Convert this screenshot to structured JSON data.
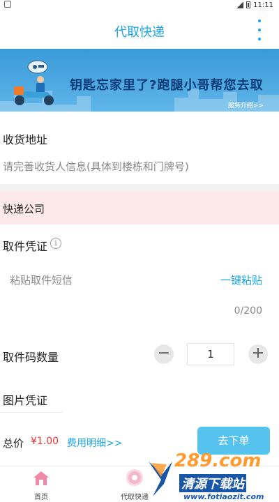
{
  "status_bar": {
    "time": "11:11"
  },
  "header": {
    "title": "代取快递"
  },
  "banner": {
    "slogan": "钥匙忘家里了?跑腿小哥帮您去取",
    "intro_link": "服务介绍>>"
  },
  "address": {
    "label": "收货地址",
    "placeholder": "请完善收货人信息(具体到楼栋和门牌号)"
  },
  "courier_company": {
    "label": "快递公司"
  },
  "pickup_proof": {
    "label": "取件凭证",
    "info_icon": "i",
    "sms_placeholder": "粘贴取件短信",
    "paste_button": "一键粘贴",
    "char_count": "0/200"
  },
  "quantity": {
    "label": "取件码数量",
    "value": "1",
    "minus": "−",
    "plus": "+"
  },
  "image_proof": {
    "label": "图片凭证"
  },
  "footer": {
    "total_label": "总价",
    "price": "¥1.00",
    "fee_details_link": "费用明细>>",
    "submit_button": "去下单"
  },
  "tabbar": {
    "tabs": [
      {
        "label": "首页",
        "icon": "home-icon"
      },
      {
        "label": "代取快递",
        "icon": "courier-icon"
      }
    ]
  },
  "watermark": {
    "line1": "289.com",
    "line2": "清源下载站",
    "line3": "www.fotiaozit.com"
  },
  "colors": {
    "accent": "#1aa4e6",
    "price": "#ee3333",
    "pink_bar": "#fde9ea",
    "submit": "#56c3ee"
  }
}
